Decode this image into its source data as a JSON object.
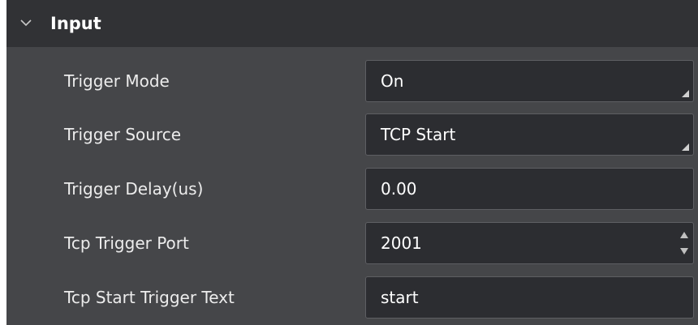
{
  "section": {
    "title": "Input",
    "chevron_icon": "chevron-down-icon"
  },
  "properties": [
    {
      "label": "Trigger Mode",
      "value": "On",
      "control": "dropdown"
    },
    {
      "label": "Trigger Source",
      "value": "TCP Start",
      "control": "dropdown"
    },
    {
      "label": "Trigger Delay(us)",
      "value": "0.00",
      "control": "text"
    },
    {
      "label": "Tcp Trigger Port",
      "value": "2001",
      "control": "spinbox"
    },
    {
      "label": "Tcp Start Trigger Text",
      "value": "start",
      "control": "text"
    }
  ],
  "colors": {
    "panel_bg": "#454649",
    "header_bg": "#313235",
    "field_bg": "#2c2d31",
    "field_border": "#5e5f63",
    "text": "#ffffff"
  }
}
